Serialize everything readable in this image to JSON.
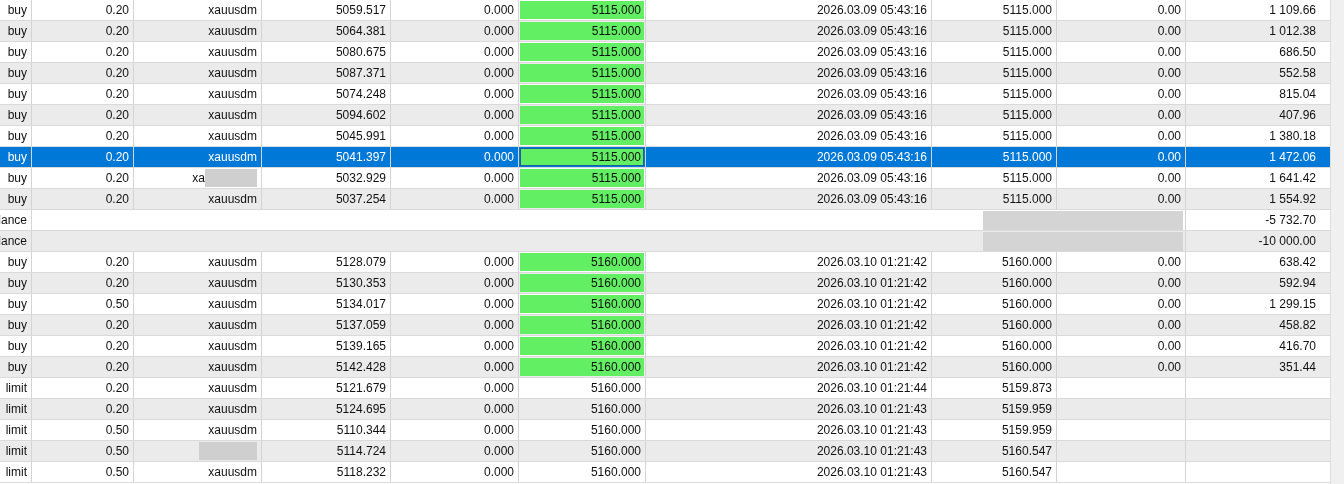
{
  "rows": [
    {
      "kind": "trade",
      "selected": false,
      "type": "buy",
      "volume": "0.20",
      "symbol": "xauusdm",
      "price": "5059.517",
      "sl": "0.000",
      "tp": "5115.000",
      "tp_hit": true,
      "time": "2026.03.09 05:43:16",
      "close_price": "5115.000",
      "swap": "0.00",
      "profit": "1 109.66"
    },
    {
      "kind": "trade",
      "selected": false,
      "type": "buy",
      "volume": "0.20",
      "symbol": "xauusdm",
      "price": "5064.381",
      "sl": "0.000",
      "tp": "5115.000",
      "tp_hit": true,
      "time": "2026.03.09 05:43:16",
      "close_price": "5115.000",
      "swap": "0.00",
      "profit": "1 012.38"
    },
    {
      "kind": "trade",
      "selected": false,
      "type": "buy",
      "volume": "0.20",
      "symbol": "xauusdm",
      "price": "5080.675",
      "sl": "0.000",
      "tp": "5115.000",
      "tp_hit": true,
      "time": "2026.03.09 05:43:16",
      "close_price": "5115.000",
      "swap": "0.00",
      "profit": "686.50"
    },
    {
      "kind": "trade",
      "selected": false,
      "type": "buy",
      "volume": "0.20",
      "symbol": "xauusdm",
      "price": "5087.371",
      "sl": "0.000",
      "tp": "5115.000",
      "tp_hit": true,
      "time": "2026.03.09 05:43:16",
      "close_price": "5115.000",
      "swap": "0.00",
      "profit": "552.58"
    },
    {
      "kind": "trade",
      "selected": false,
      "type": "buy",
      "volume": "0.20",
      "symbol": "xauusdm",
      "price": "5074.248",
      "sl": "0.000",
      "tp": "5115.000",
      "tp_hit": true,
      "time": "2026.03.09 05:43:16",
      "close_price": "5115.000",
      "swap": "0.00",
      "profit": "815.04"
    },
    {
      "kind": "trade",
      "selected": false,
      "type": "buy",
      "volume": "0.20",
      "symbol": "xauusdm",
      "price": "5094.602",
      "sl": "0.000",
      "tp": "5115.000",
      "tp_hit": true,
      "time": "2026.03.09 05:43:16",
      "close_price": "5115.000",
      "swap": "0.00",
      "profit": "407.96"
    },
    {
      "kind": "trade",
      "selected": false,
      "type": "buy",
      "volume": "0.20",
      "symbol": "xauusdm",
      "price": "5045.991",
      "sl": "0.000",
      "tp": "5115.000",
      "tp_hit": true,
      "time": "2026.03.09 05:43:16",
      "close_price": "5115.000",
      "swap": "0.00",
      "profit": "1 380.18"
    },
    {
      "kind": "trade",
      "selected": true,
      "type": "buy",
      "volume": "0.20",
      "symbol": "xauusdm",
      "price": "5041.397",
      "sl": "0.000",
      "tp": "5115.000",
      "tp_hit": true,
      "time": "2026.03.09 05:43:16",
      "close_price": "5115.000",
      "swap": "0.00",
      "profit": "1 472.06"
    },
    {
      "kind": "trade",
      "selected": false,
      "type": "buy",
      "volume": "0.20",
      "symbol": "xa",
      "symbol_redacted": true,
      "price": "5032.929",
      "sl": "0.000",
      "tp": "5115.000",
      "tp_hit": true,
      "time": "2026.03.09 05:43:16",
      "close_price": "5115.000",
      "swap": "0.00",
      "profit": "1 641.42"
    },
    {
      "kind": "trade",
      "selected": false,
      "type": "buy",
      "volume": "0.20",
      "symbol": "xauusdm",
      "price": "5037.254",
      "sl": "0.000",
      "tp": "5115.000",
      "tp_hit": true,
      "time": "2026.03.09 05:43:16",
      "close_price": "5115.000",
      "swap": "0.00",
      "profit": "1 554.92"
    },
    {
      "kind": "balance",
      "selected": false,
      "type": "lance",
      "profit": "-5 732.70"
    },
    {
      "kind": "balance",
      "selected": false,
      "type": "lance",
      "profit": "-10 000.00"
    },
    {
      "kind": "trade",
      "selected": false,
      "type": "buy",
      "volume": "0.20",
      "symbol": "xauusdm",
      "price": "5128.079",
      "sl": "0.000",
      "tp": "5160.000",
      "tp_hit": true,
      "time": "2026.03.10 01:21:42",
      "close_price": "5160.000",
      "swap": "0.00",
      "profit": "638.42"
    },
    {
      "kind": "trade",
      "selected": false,
      "type": "buy",
      "volume": "0.20",
      "symbol": "xauusdm",
      "price": "5130.353",
      "sl": "0.000",
      "tp": "5160.000",
      "tp_hit": true,
      "time": "2026.03.10 01:21:42",
      "close_price": "5160.000",
      "swap": "0.00",
      "profit": "592.94"
    },
    {
      "kind": "trade",
      "selected": false,
      "type": "buy",
      "volume": "0.50",
      "symbol": "xauusdm",
      "price": "5134.017",
      "sl": "0.000",
      "tp": "5160.000",
      "tp_hit": true,
      "time": "2026.03.10 01:21:42",
      "close_price": "5160.000",
      "swap": "0.00",
      "profit": "1 299.15"
    },
    {
      "kind": "trade",
      "selected": false,
      "type": "buy",
      "volume": "0.20",
      "symbol": "xauusdm",
      "price": "5137.059",
      "sl": "0.000",
      "tp": "5160.000",
      "tp_hit": true,
      "time": "2026.03.10 01:21:42",
      "close_price": "5160.000",
      "swap": "0.00",
      "profit": "458.82"
    },
    {
      "kind": "trade",
      "selected": false,
      "type": "buy",
      "volume": "0.20",
      "symbol": "xauusdm",
      "price": "5139.165",
      "sl": "0.000",
      "tp": "5160.000",
      "tp_hit": true,
      "time": "2026.03.10 01:21:42",
      "close_price": "5160.000",
      "swap": "0.00",
      "profit": "416.70"
    },
    {
      "kind": "trade",
      "selected": false,
      "type": "buy",
      "volume": "0.20",
      "symbol": "xauusdm",
      "price": "5142.428",
      "sl": "0.000",
      "tp": "5160.000",
      "tp_hit": true,
      "time": "2026.03.10 01:21:42",
      "close_price": "5160.000",
      "swap": "0.00",
      "profit": "351.44"
    },
    {
      "kind": "trade",
      "selected": false,
      "type": "limit",
      "volume": "0.20",
      "symbol": "xauusdm",
      "price": "5121.679",
      "sl": "0.000",
      "tp": "5160.000",
      "tp_hit": false,
      "time": "2026.03.10 01:21:44",
      "close_price": "5159.873"
    },
    {
      "kind": "trade",
      "selected": false,
      "type": "limit",
      "volume": "0.20",
      "symbol": "xauusdm",
      "price": "5124.695",
      "sl": "0.000",
      "tp": "5160.000",
      "tp_hit": false,
      "time": "2026.03.10 01:21:43",
      "close_price": "5159.959"
    },
    {
      "kind": "trade",
      "selected": false,
      "type": "limit",
      "volume": "0.50",
      "symbol": "xauusdm",
      "price": "5110.344",
      "sl": "0.000",
      "tp": "5160.000",
      "tp_hit": false,
      "time": "2026.03.10 01:21:43",
      "close_price": "5159.959"
    },
    {
      "kind": "trade",
      "selected": false,
      "type": "limit",
      "volume": "0.50",
      "symbol_redacted": true,
      "price": "5114.724",
      "sl": "0.000",
      "tp": "5160.000",
      "tp_hit": false,
      "time": "2026.03.10 01:21:43",
      "close_price": "5160.547"
    },
    {
      "kind": "trade",
      "selected": false,
      "type": "limit",
      "volume": "0.50",
      "symbol": "xauusdm",
      "price": "5118.232",
      "sl": "0.000",
      "tp": "5160.000",
      "tp_hit": false,
      "time": "2026.03.10 01:21:43",
      "close_price": "5160.547"
    }
  ]
}
